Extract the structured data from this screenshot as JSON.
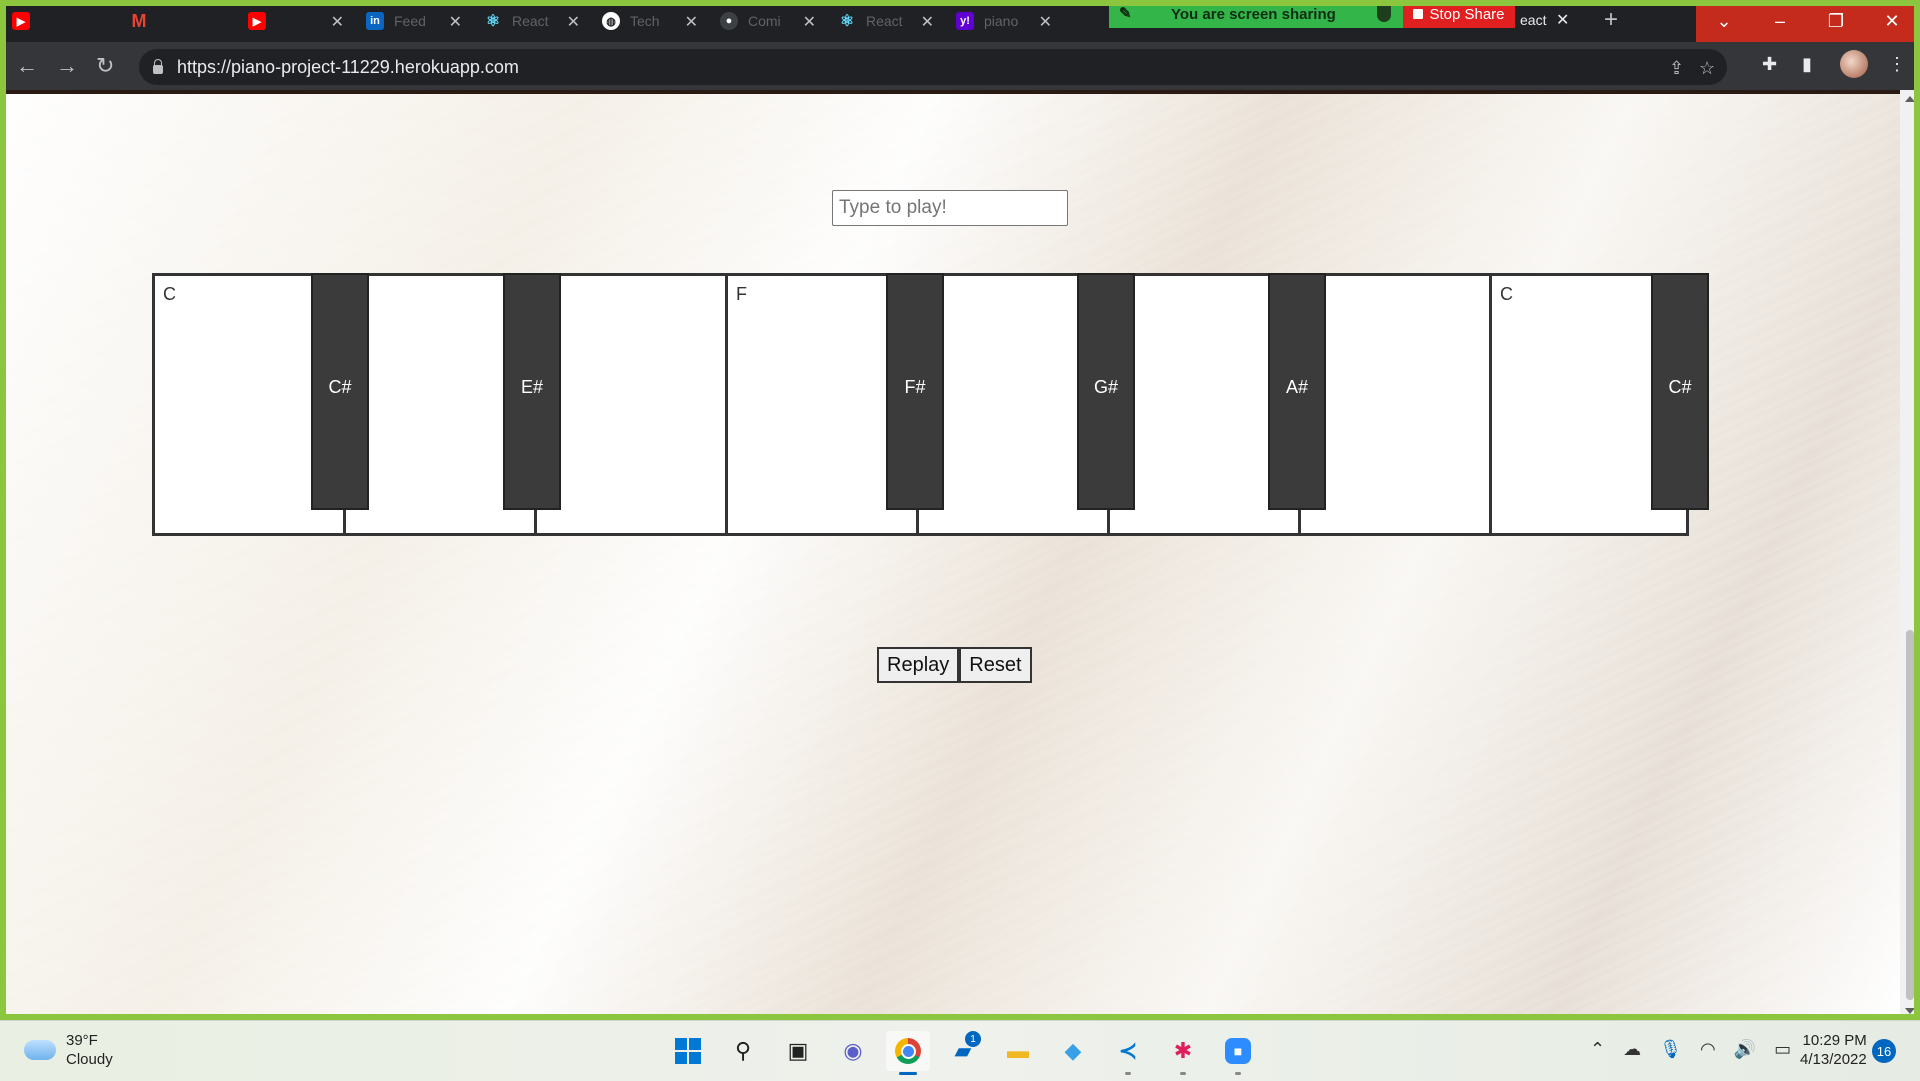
{
  "browser": {
    "tabs": [
      {
        "icon": "youtube-icon",
        "label": "",
        "color": "#ff0000"
      },
      {
        "icon": "gmail-icon",
        "label": "",
        "color": "#ea4335"
      },
      {
        "icon": "youtube-icon",
        "label": "",
        "color": "#ff0000"
      },
      {
        "icon": "linkedin-icon",
        "label": "Feed",
        "color": "#0a66c2"
      },
      {
        "icon": "react-icon",
        "label": "React",
        "color": "#61dafb"
      },
      {
        "icon": "globe-icon",
        "label": "Tech",
        "color": "#ffffff"
      },
      {
        "icon": "github-icon",
        "label": "Comi",
        "color": "#5f6368"
      },
      {
        "icon": "react-icon",
        "label": "React",
        "color": "#61dafb"
      },
      {
        "icon": "yahoo-icon",
        "label": "piano",
        "color": "#6001d2"
      }
    ],
    "last_tab_label": "eact",
    "new_tab_symbol": "+",
    "screen_share_text": "You are screen sharing",
    "stop_share_label": "Stop Share",
    "url": "https://piano-project-11229.herokuapp.com"
  },
  "page": {
    "input_placeholder": "Type to play!",
    "white_keys": [
      {
        "label": "C"
      },
      {
        "label": ""
      },
      {
        "label": ""
      },
      {
        "label": "F"
      },
      {
        "label": ""
      },
      {
        "label": ""
      },
      {
        "label": ""
      },
      {
        "label": "C"
      }
    ],
    "black_keys": [
      "C#",
      "E#",
      "F#",
      "G#",
      "A#",
      "C#"
    ],
    "replay_label": "Replay",
    "reset_label": "Reset"
  },
  "taskbar": {
    "temperature": "39°F",
    "condition": "Cloudy",
    "time": "10:29 PM",
    "date": "4/13/2022",
    "notification_count": "16",
    "teams_badge": "1",
    "accent_color": "#0067c0"
  }
}
